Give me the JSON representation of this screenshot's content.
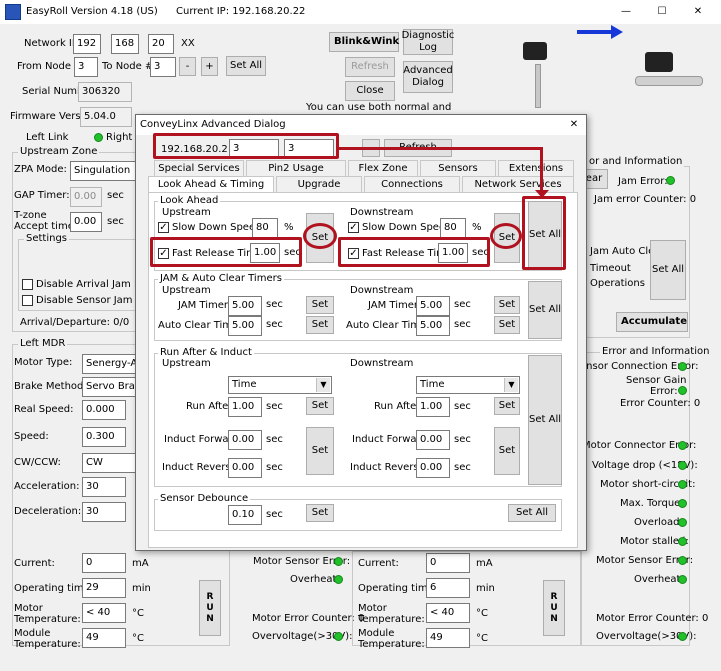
{
  "window": {
    "app_title": "EasyRoll Version 4.18 (US)",
    "current_ip": "Current IP: 192.168.20.22",
    "minimize": "—",
    "maximize": "☐",
    "close": "✕"
  },
  "main": {
    "network_ip_label": "Network IP:",
    "ip1": "192",
    "ip2": "168",
    "ip3": "20",
    "ip4": "XX",
    "blink_wink": "Blink&Wink",
    "diagnostic_log": "Diagnostic Log",
    "from_node_label": "From Node #:",
    "from_node": "3",
    "to_node_label": "To Node #:",
    "to_node": "3",
    "minus": "-",
    "plus": "+",
    "set_all": "Set All",
    "refresh": "Refresh",
    "advanced_dialog": "Advanced Dialog",
    "close": "Close",
    "serial_label": "Serial Number:",
    "serial": "306320",
    "firmware_label": "Firmware Version:",
    "firmware": "5.04.0",
    "note": "You can use both normal and",
    "left_link": "Left Link",
    "right_link": "Right L",
    "upstream_zone": "Upstream Zone",
    "zpa_mode_label": "ZPA Mode:",
    "zpa_mode": "Singulation",
    "gap_timer_label": "GAP Timer:",
    "gap_timer": "0.00",
    "sec": "sec",
    "tzone_label_1": "T-zone",
    "tzone_label_2": "Accept time:",
    "tzone": "0.00",
    "settings": "Settings",
    "disable_arrival": "Disable Arrival Jam Rese",
    "disable_sensor": "Disable Sensor Jam Rese",
    "arrival_departure": "Arrival/Departure: 0/0",
    "error_info": "or and Information",
    "clear": "ear",
    "jam_error": "Jam Error:",
    "jam_counter": "Jam error Counter: 0",
    "jam_auto_clear": "Jam Auto Clear",
    "timeout": "Timeout",
    "operations": "Operations",
    "set_all_right": "Set All",
    "accumulate": "Accumulate",
    "left_mdr": "Left MDR",
    "motor_type_label": "Motor Type:",
    "motor_type": "Senergy-Ai ECO",
    "brake_label": "Brake Method:",
    "brake": "Servo Brake",
    "real_speed_label": "Real Speed:",
    "real_speed": "0.000",
    "speed_label": "Speed:",
    "speed": "0.300",
    "cwccw_label": "CW/CCW:",
    "cwccw": "CW",
    "accel_label": "Acceleration:",
    "accel": "30",
    "decel_label": "Deceleration:",
    "decel": "30",
    "current_label": "Current:",
    "current": "0",
    "ma": "mA",
    "optime_label": "Operating time:",
    "optime": "29",
    "min": "min",
    "motortemp_label_1": "Motor",
    "motortemp_label_2": "Temperature:",
    "motortemp": "< 40",
    "degc": "°C",
    "modtemp_label_1": "Module",
    "modtemp_label_2": "Temperature:",
    "modtemp": "49",
    "r_current": "0",
    "r_optime": "6",
    "r_motortemp": "< 40",
    "r_modtemp": "49",
    "run": "RUN",
    "motor_sensor_error": "Motor Sensor Error:",
    "overheat": "Overheat:",
    "motor_error_counter": "Motor Error Counter: 0",
    "overvoltage": "Overvoltage(>30V):",
    "rp_error_info": "Error and Information",
    "rp_sensor_conn": "ensor Connection Error:",
    "rp_sensor_gain_1": "Sensor Gain",
    "rp_sensor_gain_2": "Error:",
    "rp_error_counter": "Error Counter: 0",
    "rp_motor_conn": "Motor Connector Error:",
    "rp_voltage_drop": "Voltage drop (<18V):",
    "rp_short": "Motor short-circuit:",
    "rp_max_torque": "Max. Torque:",
    "rp_overload": "Overload:",
    "rp_stalled": "Motor stalled:",
    "rp_motor_sensor": "Motor Sensor Error:",
    "rp_overheat": "Overheat:",
    "rp_motor_counter": "Motor Error Counter: 0",
    "rp_overvoltage": "Overvoltage(>30V):"
  },
  "dialog": {
    "title": "ConveyLinx Advanced Dialog",
    "close": "✕",
    "ip": "192.168.20.22",
    "node_a": "3",
    "node_b": "3",
    "refresh": "Refresh",
    "tabs_row1": [
      "Special Services",
      "Pin2 Usage",
      "Flex Zone",
      "Sensors",
      "Extensions"
    ],
    "tabs_row2": [
      "Look Ahead & Timing",
      "Upgrade",
      "Connections",
      "Network Services"
    ],
    "look_ahead": "Look Ahead",
    "upstream": "Upstream",
    "downstream": "Downstream",
    "slow_down_speed": "Slow Down Speed",
    "slow_up": "80",
    "slow_down": "80",
    "pct": "%",
    "fast_release": "Fast Release Time",
    "fr_up": "1.00",
    "fr_down": "1.00",
    "sec": "sec",
    "set": "Set",
    "set_all": "Set All",
    "jam_group": "JAM & Auto Clear Timers",
    "jam_timer": "JAM Timer:",
    "jam_up": "5.00",
    "jam_down": "5.00",
    "auto_clear": "Auto Clear Timer:",
    "ac_up": "5.00",
    "ac_down": "5.00",
    "run_after_group": "Run After & Induct",
    "time": "Time",
    "run_after": "Run After:",
    "ra_up": "1.00",
    "ra_down": "1.00",
    "induct_fwd": "Induct Forward:",
    "if_up": "0.00",
    "if_down": "0.00",
    "induct_rev": "Induct Reverse:",
    "ir_up": "0.00",
    "ir_down": "0.00",
    "sensor_debounce": "Sensor Debounce",
    "debounce": "0.10"
  }
}
